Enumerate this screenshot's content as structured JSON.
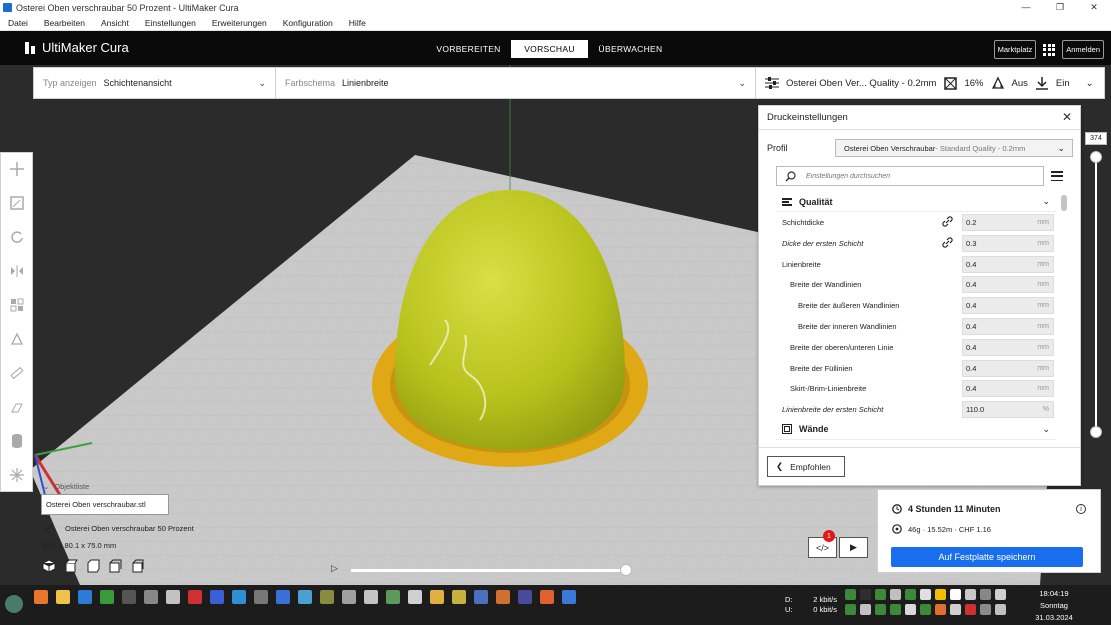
{
  "window": {
    "title": "Osterei Oben verschraubar 50 Prozent - UltiMaker Cura"
  },
  "menu": [
    "Datei",
    "Bearbeiten",
    "Ansicht",
    "Einstellungen",
    "Erweiterungen",
    "Konfiguration",
    "Hilfe"
  ],
  "header": {
    "logo_text": "UltiMaker Cura",
    "tabs": [
      "VORBEREITEN",
      "VORSCHAU",
      "ÜBERWACHEN"
    ],
    "active_tab": "VORSCHAU",
    "marketplace": "Marktplatz",
    "signin": "Anmelden"
  },
  "stagebar": {
    "view_type_label": "Typ anzeigen",
    "view_type_value": "Schichtenansicht",
    "color_scheme_label": "Farbschema",
    "color_scheme_value": "Linienbreite",
    "print_profile": "Osterei Oben Ver... Quality - 0.2mm",
    "infill": "16%",
    "support": "Aus",
    "adhesion": "Ein"
  },
  "panel": {
    "title": "Druckeinstellungen",
    "profile_label": "Profil",
    "profile_name": "Osterei Oben Verschraubar",
    "profile_sub": " - Standard Quality - 0.2mm",
    "search_placeholder": "Einstellungen durchsuchen",
    "category_quality": "Qualität",
    "category_walls": "Wände",
    "recommended": "Empfohlen",
    "settings": [
      {
        "label": "Schichtdicke",
        "value": "0.2",
        "unit": "mm",
        "indent": 0,
        "italic": false,
        "linked": true
      },
      {
        "label": "Dicke der ersten Schicht",
        "value": "0.3",
        "unit": "mm",
        "indent": 0,
        "italic": true,
        "linked": true
      },
      {
        "label": "Linienbreite",
        "value": "0.4",
        "unit": "mm",
        "indent": 0,
        "italic": false,
        "linked": false
      },
      {
        "label": "Breite der Wandlinien",
        "value": "0.4",
        "unit": "mm",
        "indent": 1,
        "italic": false,
        "linked": false
      },
      {
        "label": "Breite der äußeren Wandlinien",
        "value": "0.4",
        "unit": "mm",
        "indent": 2,
        "italic": false,
        "linked": false
      },
      {
        "label": "Breite der inneren Wandlinien",
        "value": "0.4",
        "unit": "mm",
        "indent": 2,
        "italic": false,
        "linked": false
      },
      {
        "label": "Breite der oberen/unteren Linie",
        "value": "0.4",
        "unit": "mm",
        "indent": 1,
        "italic": false,
        "linked": false
      },
      {
        "label": "Breite der Füllinien",
        "value": "0.4",
        "unit": "mm",
        "indent": 1,
        "italic": false,
        "linked": false
      },
      {
        "label": "Skirt-/Brim-Linienbreite",
        "value": "0.4",
        "unit": "mm",
        "indent": 1,
        "italic": false,
        "linked": false
      },
      {
        "label": "Linienbreite der ersten Schicht",
        "value": "110.0",
        "unit": "%",
        "indent": 0,
        "italic": true,
        "linked": false
      }
    ]
  },
  "layer_slider": {
    "current_layer": "374"
  },
  "object_list": {
    "heading": "Objektliste",
    "file": "Osterei Oben verschraubar.stl",
    "name": "Osterei Oben verschraubar 50 Prozent",
    "dimensions": "80.2 x 80.1 x 75.0 mm"
  },
  "output": {
    "time": "4 Stunden 11 Minuten",
    "material": "46g · 15.52m · CHF 1.16",
    "save_button": "Auf Festplatte speichern",
    "badge_count": "1"
  },
  "taskbar": {
    "net_down_label": "D:",
    "net_down": "2 kbit/s",
    "net_up_label": "U:",
    "net_up": "0 kbit/s",
    "time": "18:04:19",
    "day": "Sonntag",
    "date": "31.03.2024"
  },
  "colors": {
    "accent": "#196ef0",
    "model": "#c6cf21",
    "brim": "#e0a814",
    "badge": "#e01a1a"
  }
}
